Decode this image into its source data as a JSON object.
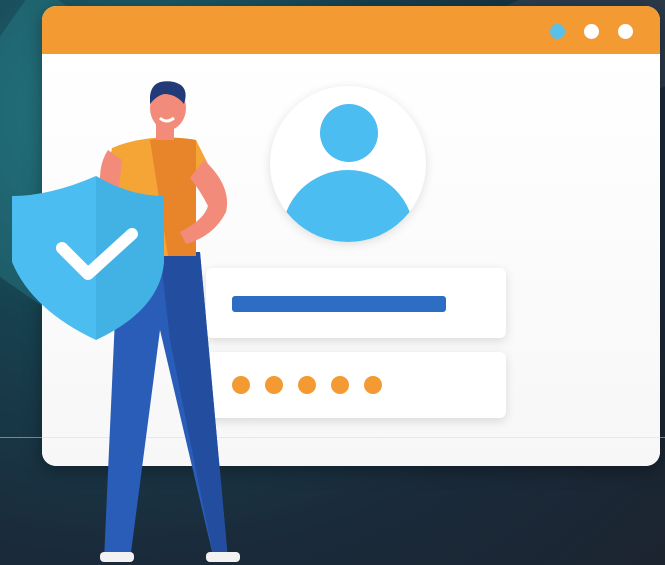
{
  "colors": {
    "titlebar": "#f39a32",
    "window_dot_active": "#5bc0e8",
    "window_dot": "#ffffff",
    "avatar": "#4cbdf0",
    "username_bar": "#2d6dc4",
    "password_dots": "#f39a32",
    "shield": "#4cbdf0",
    "shield_check": "#ffffff"
  },
  "window": {
    "controls": [
      "dot",
      "dot",
      "dot"
    ]
  },
  "login_form": {
    "avatar_icon": "user-avatar-icon",
    "password_dot_count": 5
  },
  "illustration": {
    "character": "man-holding-shield",
    "shield_icon": "check-shield-icon"
  }
}
